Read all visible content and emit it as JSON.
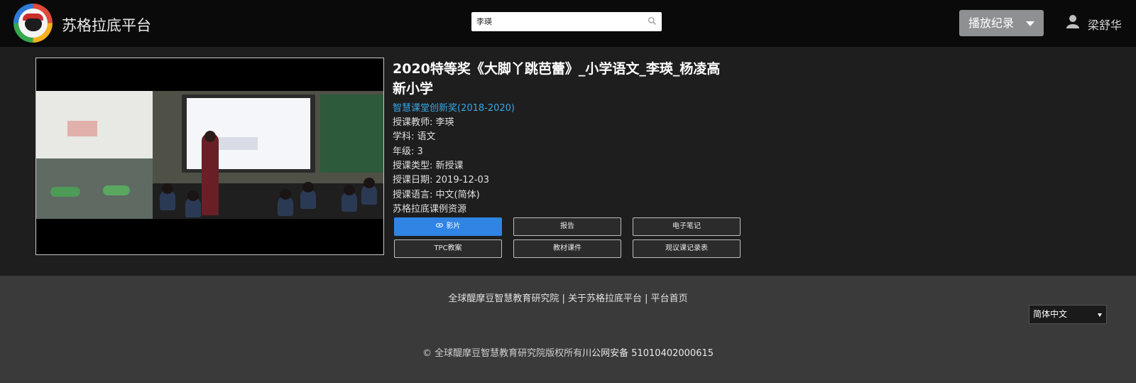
{
  "header": {
    "brand": "苏格拉底平台",
    "search": {
      "value": "李瑛",
      "placeholder": ""
    },
    "record_button": "播放纪录",
    "user_name": "梁舒华"
  },
  "lesson": {
    "title": "2020特等奖《大脚丫跳芭蕾》_小学语文_李瑛_杨凌高新小学",
    "award": "智慧课堂创新奖(2018-2020)",
    "teacher": "授课教师: 李瑛",
    "subject": "学科: 语文",
    "grade": "年级: 3",
    "lesson_type": "授课类型: 新授课",
    "date": "授课日期: 2019-12-03",
    "language": "授课语言: 中文(简体)",
    "resource": "苏格拉底课例资源"
  },
  "buttons": {
    "video": "影片",
    "report": "报告",
    "e_notes": "电子笔记",
    "tpc_plan": "TPC教案",
    "materials": "教材课件",
    "observation": "观议课记录表"
  },
  "footer": {
    "links": "全球醍摩豆智慧教育研究院 | 关于苏格拉底平台 | 平台首页",
    "language": "简体中文",
    "copyright_prefix": "© 全球醍摩豆智慧教育研究院版权所有",
    "police_record": "川公网安备 51010402000615"
  },
  "colors": {
    "header_bg": "#0a0a0a",
    "main_bg": "#1e1e1e",
    "footer_bg": "#3a3a3a",
    "primary_button": "#2f84e4",
    "award_link": "#35a8ea"
  },
  "icons": {
    "search": "search-icon",
    "dropdown": "caret-down-icon",
    "user": "user-icon",
    "video_button": "eye-icon"
  }
}
